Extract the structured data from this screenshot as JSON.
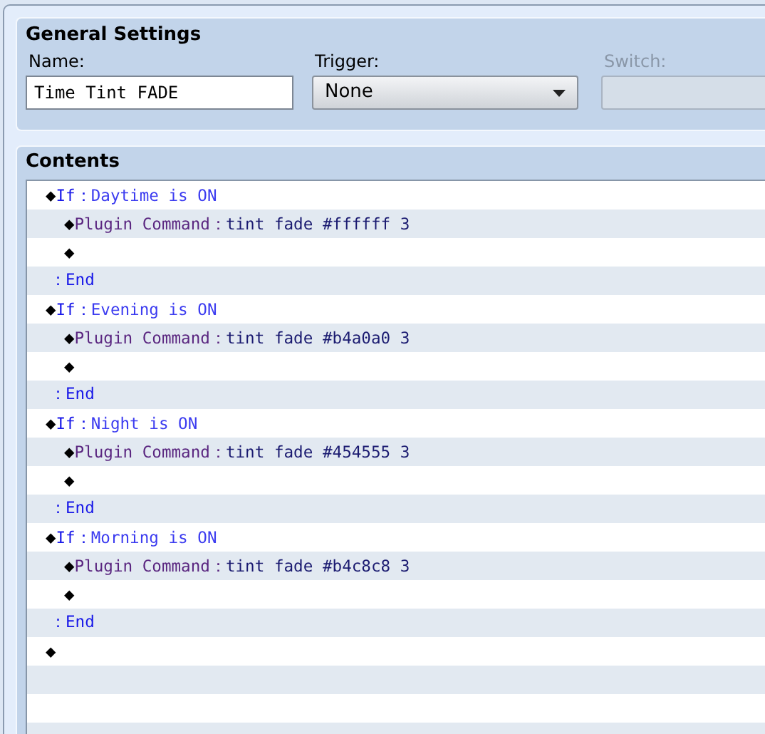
{
  "general_settings": {
    "title": "General Settings",
    "name": {
      "label": "Name:",
      "value": "Time Tint FADE"
    },
    "trigger": {
      "label": "Trigger:",
      "value": "None"
    },
    "switch": {
      "label": "Switch:",
      "disabled": true
    }
  },
  "contents": {
    "title": "Contents",
    "items": [
      {
        "kind": "if",
        "marker": "◆",
        "keyword": "If",
        "separator": "：",
        "condition": "Daytime is ON",
        "children": [
          {
            "kind": "command",
            "marker": "◆",
            "label": "Plugin Command",
            "separator": "：",
            "text": "tint fade #ffffff 3"
          },
          {
            "kind": "blank",
            "marker": "◆"
          }
        ],
        "end": {
          "separator": "：",
          "label": "End"
        }
      },
      {
        "kind": "if",
        "marker": "◆",
        "keyword": "If",
        "separator": "：",
        "condition": "Evening is ON",
        "children": [
          {
            "kind": "command",
            "marker": "◆",
            "label": "Plugin Command",
            "separator": "：",
            "text": "tint fade #b4a0a0 3"
          },
          {
            "kind": "blank",
            "marker": "◆"
          }
        ],
        "end": {
          "separator": "：",
          "label": "End"
        }
      },
      {
        "kind": "if",
        "marker": "◆",
        "keyword": "If",
        "separator": "：",
        "condition": "Night is ON",
        "children": [
          {
            "kind": "command",
            "marker": "◆",
            "label": "Plugin Command",
            "separator": "：",
            "text": "tint fade #454555 3"
          },
          {
            "kind": "blank",
            "marker": "◆"
          }
        ],
        "end": {
          "separator": "：",
          "label": "End"
        }
      },
      {
        "kind": "if",
        "marker": "◆",
        "keyword": "If",
        "separator": "：",
        "condition": "Morning is ON",
        "children": [
          {
            "kind": "command",
            "marker": "◆",
            "label": "Plugin Command",
            "separator": "：",
            "text": "tint fade #b4c8c8 3"
          },
          {
            "kind": "blank",
            "marker": "◆"
          }
        ],
        "end": {
          "separator": "：",
          "label": "End"
        }
      },
      {
        "kind": "blank",
        "marker": "◆"
      }
    ]
  }
}
